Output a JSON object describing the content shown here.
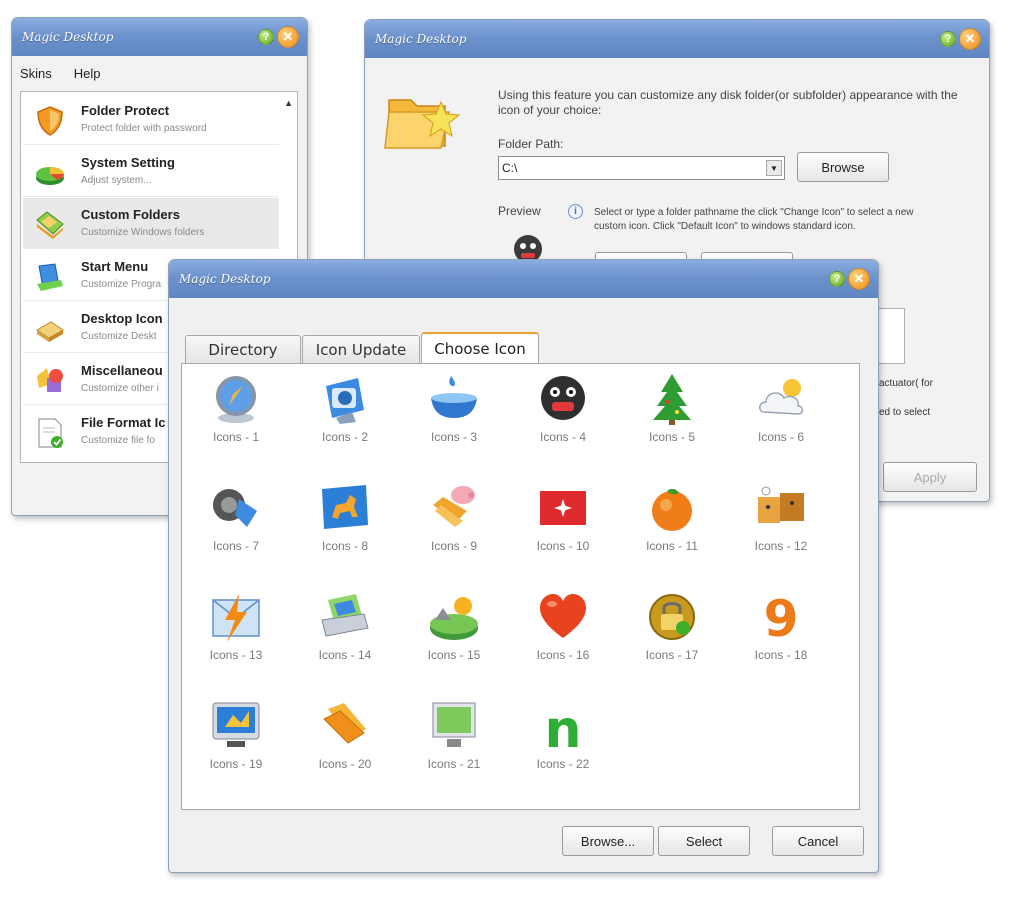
{
  "window_main": {
    "title": "Magic Desktop",
    "menu": [
      "Skins",
      "Help"
    ],
    "items": [
      {
        "title": "Folder Protect",
        "desc": "Protect folder with password",
        "icon": "shield-icon"
      },
      {
        "title": "System Setting",
        "desc": "Adjust system...",
        "icon": "pie-chart-icon"
      },
      {
        "title": "Custom Folders",
        "desc": "Customize Windows folders",
        "icon": "folder-icon"
      },
      {
        "title": "Start Menu",
        "desc": "Customize Progra",
        "icon": "start-menu-icon"
      },
      {
        "title": "Desktop Icon",
        "desc": "Customize Deskt",
        "icon": "desktop-icon"
      },
      {
        "title": "Miscellaneou",
        "desc": "Customize other i",
        "icon": "shapes-icon"
      },
      {
        "title": "File Format Ic",
        "desc": "Customize file fo",
        "icon": "file-format-icon"
      }
    ]
  },
  "window_custom": {
    "title": "Magic Desktop",
    "description": "Using this feature you can customize any disk folder(or subfolder) appearance with the icon of your choice:",
    "folder_path_label": "Folder Path:",
    "folder_path_value": "C:\\",
    "browse_label": "Browse",
    "preview_label": "Preview",
    "hint": "Select or type a folder pathname the click \"Change Icon\" to select a new custom icon. Click \"Default Icon\" to windows standard icon.",
    "right_text_1": "actuator( for",
    "right_text_2": "ed to select",
    "apply_label": "Apply"
  },
  "window_choose": {
    "title": "Magic Desktop",
    "tabs": [
      "Directory",
      "Icon Update",
      "Choose Icon"
    ],
    "active_tab": 2,
    "icons": [
      "Icons - 1",
      "Icons - 2",
      "Icons - 3",
      "Icons - 4",
      "Icons - 5",
      "Icons - 6",
      "Icons - 7",
      "Icons - 8",
      "Icons - 9",
      "Icons - 10",
      "Icons - 11",
      "Icons - 12",
      "Icons - 13",
      "Icons - 14",
      "Icons - 15",
      "Icons - 16",
      "Icons - 17",
      "Icons - 18",
      "Icons - 19",
      "Icons - 20",
      "Icons - 21",
      "Icons - 22"
    ],
    "browse_label": "Browse...",
    "select_label": "Select",
    "cancel_label": "Cancel"
  }
}
